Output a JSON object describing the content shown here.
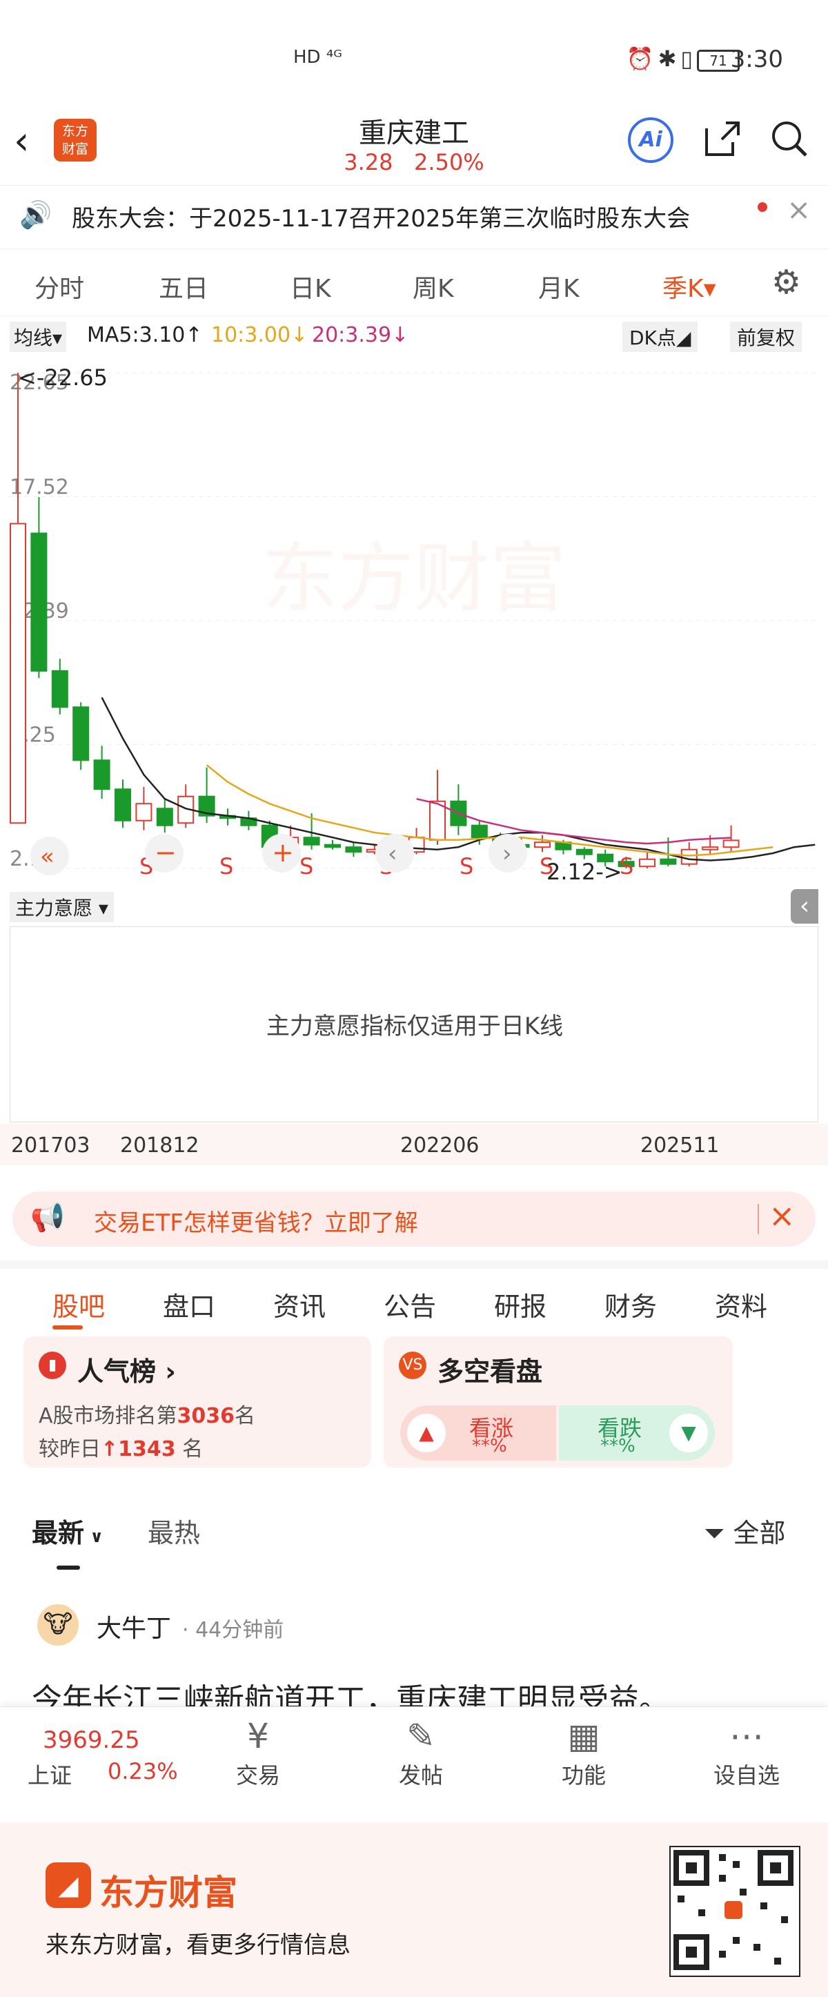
{
  "status_bar": {
    "left": "HD ⁴ᴳ",
    "time": "3:30",
    "battery": "71"
  },
  "header": {
    "logo_text": "东方\n财富",
    "name": "重庆建工",
    "price": "3.28",
    "change_pct": "2.50%",
    "ai_label": "Ai"
  },
  "notice": {
    "text": "股东大会：于2025-11-17召开2025年第三次临时股东大会"
  },
  "period_tabs": [
    {
      "label": "分时"
    },
    {
      "label": "五日"
    },
    {
      "label": "日K"
    },
    {
      "label": "周K"
    },
    {
      "label": "月K"
    },
    {
      "label": "季K▾"
    }
  ],
  "ma_bar": {
    "mode": "均线▾",
    "ma5": "MA5:3.10↑",
    "ma10": "10:3.00↓",
    "ma20": "20:3.39↓",
    "dk": "DK点◢",
    "fq": "前复权"
  },
  "chart_data": {
    "type": "candlestick",
    "y_ticks": [
      "22.65",
      "17.52",
      "12.39",
      "7.25",
      "2.12"
    ],
    "ylim": [
      2.12,
      22.65
    ],
    "max_label": "<-22.65",
    "min_label": "2.12->",
    "watermark": "东方财富",
    "markers": [
      "S",
      "S",
      "S",
      "S",
      "S",
      "S",
      "S"
    ],
    "x_labels": [
      "201703",
      "201812",
      "202206",
      "202511"
    ],
    "candles": [
      {
        "o": 4.0,
        "c": 16.4,
        "h": 22.65,
        "l": 4.0
      },
      {
        "o": 16.0,
        "c": 10.3,
        "h": 17.5,
        "l": 10.0
      },
      {
        "o": 10.3,
        "c": 8.8,
        "h": 10.8,
        "l": 8.5
      },
      {
        "o": 8.8,
        "c": 6.6,
        "h": 9.0,
        "l": 6.2
      },
      {
        "o": 6.6,
        "c": 5.4,
        "h": 7.2,
        "l": 5.0
      },
      {
        "o": 5.4,
        "c": 4.1,
        "h": 5.8,
        "l": 3.8
      },
      {
        "o": 4.1,
        "c": 4.8,
        "h": 5.5,
        "l": 3.7
      },
      {
        "o": 4.6,
        "c": 3.9,
        "h": 5.0,
        "l": 3.6
      },
      {
        "o": 4.0,
        "c": 5.1,
        "h": 5.6,
        "l": 3.8
      },
      {
        "o": 5.1,
        "c": 4.3,
        "h": 6.3,
        "l": 4.0
      },
      {
        "o": 4.3,
        "c": 4.2,
        "h": 4.6,
        "l": 3.9
      },
      {
        "o": 4.2,
        "c": 3.9,
        "h": 4.5,
        "l": 3.7
      },
      {
        "o": 3.9,
        "c": 3.0,
        "h": 4.1,
        "l": 2.8
      },
      {
        "o": 3.0,
        "c": 3.4,
        "h": 3.9,
        "l": 2.8
      },
      {
        "o": 3.4,
        "c": 3.1,
        "h": 4.4,
        "l": 2.9
      },
      {
        "o": 3.1,
        "c": 3.0,
        "h": 3.3,
        "l": 2.9
      },
      {
        "o": 3.0,
        "c": 2.8,
        "h": 3.2,
        "l": 2.6
      },
      {
        "o": 2.8,
        "c": 2.9,
        "h": 3.1,
        "l": 2.7
      },
      {
        "o": 2.9,
        "c": 2.8,
        "h": 3.0,
        "l": 2.6
      },
      {
        "o": 2.8,
        "c": 3.4,
        "h": 3.8,
        "l": 2.7
      },
      {
        "o": 3.3,
        "c": 4.9,
        "h": 6.2,
        "l": 3.1
      },
      {
        "o": 4.9,
        "c": 3.9,
        "h": 5.6,
        "l": 3.5
      },
      {
        "o": 3.9,
        "c": 3.4,
        "h": 4.1,
        "l": 3.1
      },
      {
        "o": 3.4,
        "c": 3.1,
        "h": 3.6,
        "l": 2.9
      },
      {
        "o": 3.1,
        "c": 3.0,
        "h": 3.4,
        "l": 2.8
      },
      {
        "o": 3.0,
        "c": 3.2,
        "h": 3.5,
        "l": 2.8
      },
      {
        "o": 3.2,
        "c": 2.9,
        "h": 3.3,
        "l": 2.7
      },
      {
        "o": 2.9,
        "c": 2.7,
        "h": 3.0,
        "l": 2.5
      },
      {
        "o": 2.7,
        "c": 2.4,
        "h": 2.9,
        "l": 2.2
      },
      {
        "o": 2.4,
        "c": 2.2,
        "h": 2.6,
        "l": 2.12
      },
      {
        "o": 2.2,
        "c": 2.5,
        "h": 2.8,
        "l": 2.12
      },
      {
        "o": 2.5,
        "c": 2.3,
        "h": 3.4,
        "l": 2.2
      },
      {
        "o": 2.3,
        "c": 2.9,
        "h": 3.2,
        "l": 2.2
      },
      {
        "o": 2.9,
        "c": 3.0,
        "h": 3.5,
        "l": 2.7
      },
      {
        "o": 3.0,
        "c": 3.28,
        "h": 3.9,
        "l": 2.8
      }
    ],
    "ma_series": [
      {
        "name": "MA5",
        "color": "#222222",
        "start": 4,
        "values": [
          9.2,
          7.5,
          6.0,
          5.0,
          4.6,
          4.4,
          4.3,
          4.2,
          4.0,
          3.8,
          3.6,
          3.4,
          3.2,
          3.1,
          3.0,
          2.95,
          2.9,
          3.0,
          3.3,
          3.5,
          3.6,
          3.6,
          3.5,
          3.3,
          3.1,
          3.0,
          2.9,
          2.7,
          2.5,
          2.45,
          2.5,
          2.6,
          2.75,
          3.0,
          3.1
        ]
      },
      {
        "name": "MA10",
        "color": "#e5a617",
        "start": 9,
        "values": [
          6.4,
          5.7,
          5.2,
          4.8,
          4.5,
          4.2,
          4.0,
          3.8,
          3.6,
          3.5,
          3.4,
          3.3,
          3.3,
          3.35,
          3.4,
          3.4,
          3.3,
          3.2,
          3.1,
          3.0,
          2.9,
          2.8,
          2.7,
          2.65,
          2.7,
          2.8,
          2.9,
          3.0
        ]
      },
      {
        "name": "MA20",
        "color": "#c8307a",
        "start": 19,
        "values": [
          5.0,
          4.8,
          4.4,
          4.1,
          3.9,
          3.7,
          3.6,
          3.5,
          3.4,
          3.3,
          3.2,
          3.15,
          3.2,
          3.3,
          3.35,
          3.39
        ]
      }
    ]
  },
  "indicator": {
    "label": "主力意愿 ▾",
    "message": "主力意愿指标仅适用于日K线"
  },
  "ad": {
    "text": "交易ETF怎样更省钱？立即了解"
  },
  "main_tabs": [
    {
      "label": "股吧"
    },
    {
      "label": "盘口"
    },
    {
      "label": "资讯"
    },
    {
      "label": "公告"
    },
    {
      "label": "研报"
    },
    {
      "label": "财务"
    },
    {
      "label": "资料"
    }
  ],
  "popularity": {
    "title": "人气榜 ›",
    "line1_prefix": "A股市场排名第",
    "rank": "3036",
    "line1_suffix": "名",
    "line2_prefix": "较昨日",
    "delta": "↑1343",
    "line2_suffix": " 名"
  },
  "sentiment": {
    "title": "多空看盘",
    "up_label": "看涨",
    "up_pct": "**%",
    "down_label": "看跌",
    "down_pct": "**%"
  },
  "feed": {
    "tab_latest": "最新",
    "tab_hot": "最热",
    "filter": "全部",
    "post_author": "大牛丁",
    "post_time": "· 44分钟前",
    "post_text": "今年长江三峡新航道开工，重庆建工明显受益。"
  },
  "bottom_nav": {
    "index_value": "3969.25",
    "index_name": "上证",
    "index_pct": "0.23%",
    "items": [
      {
        "label": "交易"
      },
      {
        "label": "发帖"
      },
      {
        "label": "功能"
      },
      {
        "label": "设自选"
      }
    ]
  },
  "footer": {
    "brand": "东方财富",
    "slogan": "来东方财富，看更多行情信息"
  },
  "colors": {
    "accent": "#e8521c",
    "up": "#e23a2e",
    "down": "#1a9a2a"
  }
}
